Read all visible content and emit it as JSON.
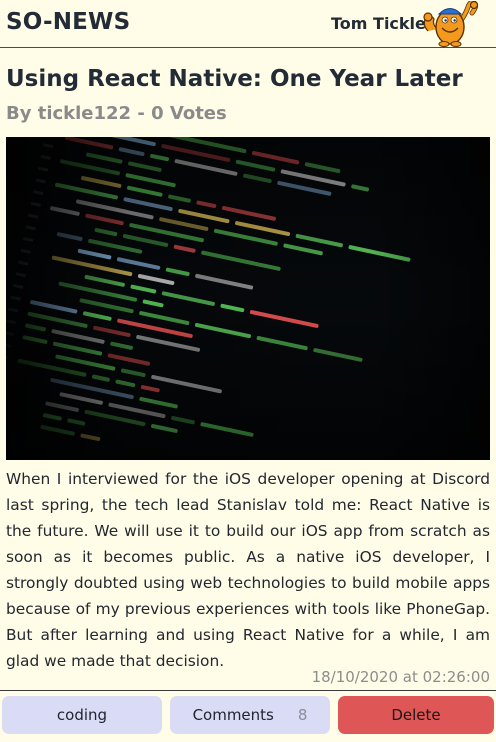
{
  "header": {
    "brand": "SO-NEWS",
    "user_name": "Tom Tickle"
  },
  "post": {
    "title": "Using React Native: One Year Later",
    "byline": "By tickle122 - 0 Votes",
    "body": "When I interviewed for the iOS developer opening at Discord last spring, the tech lead Stanislav told me: React Native is the future. We will use it to build our iOS app from scratch as soon as it becomes public. As a native iOS developer, I strongly doubted using web technologies to build mobile apps because of my previous experiences with tools like PhoneGap. But after learning and using React Native for a while, I am glad we made that decision.",
    "timestamp": "18/10/2020 at 02:26:00"
  },
  "actions": {
    "topic_label": "coding",
    "comments_label": "Comments",
    "comments_count": "8",
    "delete_label": "Delete"
  },
  "colors": {
    "background": "#fffde8",
    "button": "#dadbf5",
    "delete": "#de5656",
    "code_green": "#5cd45c"
  },
  "icons": {
    "avatar": "mr-tickle-avatar-icon"
  }
}
